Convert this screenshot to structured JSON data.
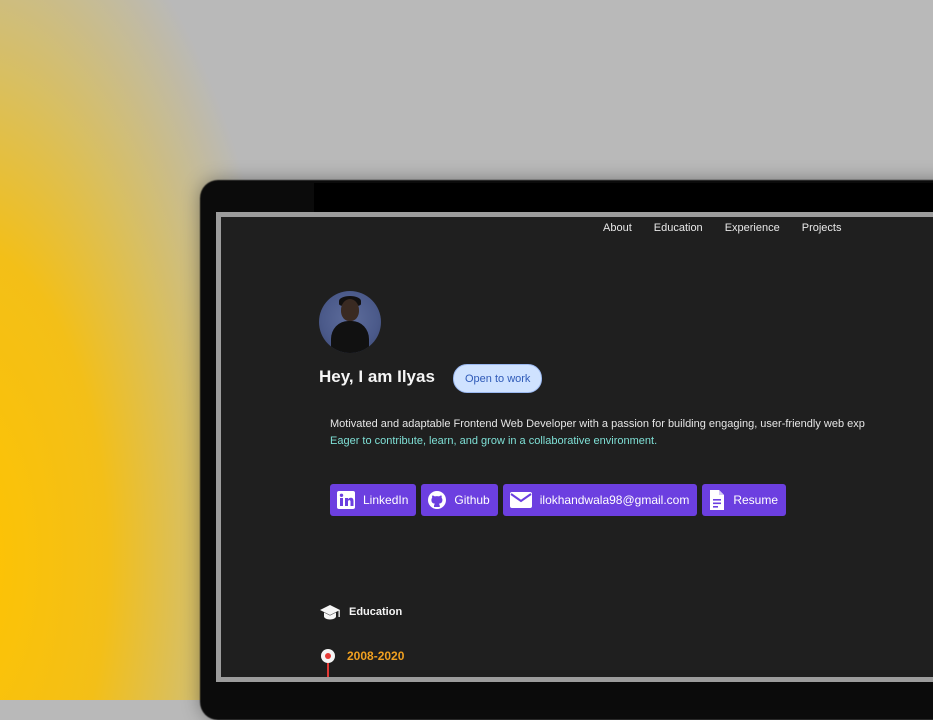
{
  "nav": {
    "items": [
      {
        "label": "About"
      },
      {
        "label": "Education"
      },
      {
        "label": "Experience"
      },
      {
        "label": "Projects"
      }
    ]
  },
  "hero": {
    "title": "Hey, I am Ilyas",
    "badge": "Open to work",
    "description_line1": "Motivated and adaptable Frontend Web Developer with a passion for building engaging, user-friendly web exp",
    "description_line2": "Eager to contribute, learn, and grow in a collaborative environment."
  },
  "links": {
    "linkedin": "LinkedIn",
    "github": "Github",
    "email": "ilokhandwala98@gmail.com",
    "resume": "Resume"
  },
  "education": {
    "heading": "Education",
    "years": "2008-2020"
  },
  "colors": {
    "accent": "#6c3fe0",
    "badge_bg": "#cfe2ff",
    "highlight_text": "#7fe0d6",
    "year_text": "#f0a020",
    "background_yellow": "#ffc400"
  }
}
